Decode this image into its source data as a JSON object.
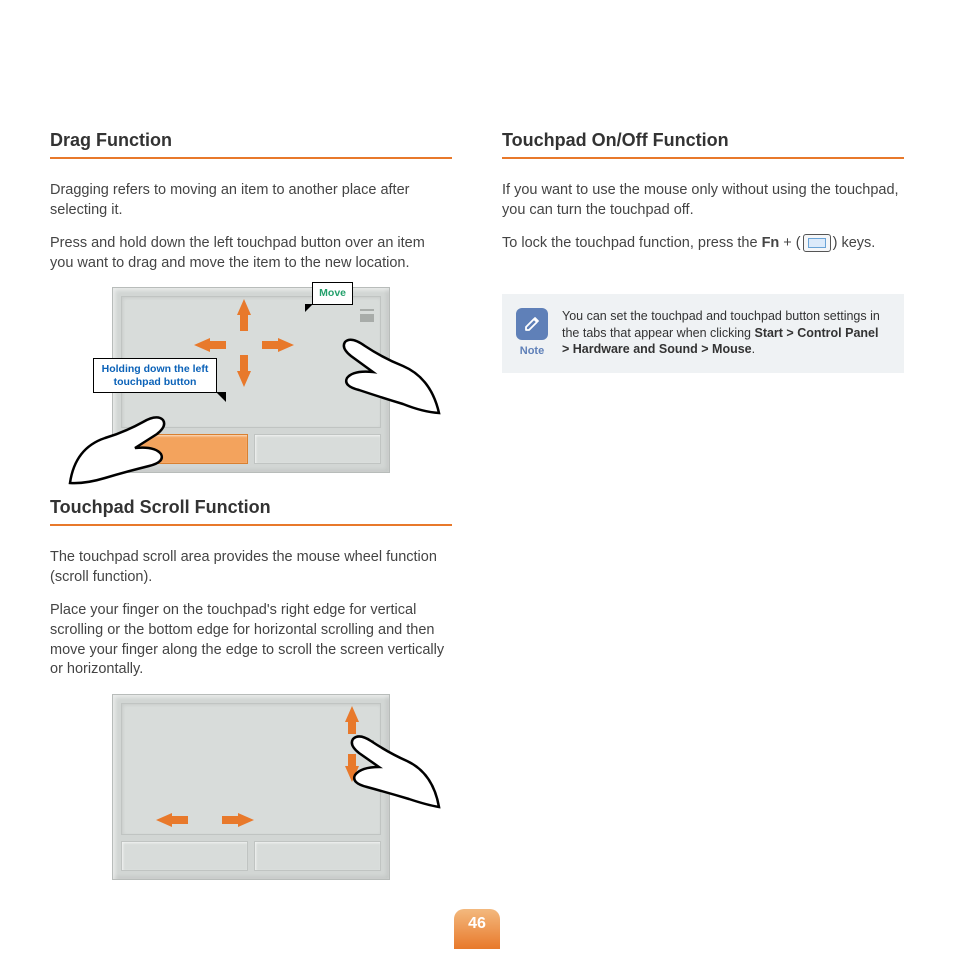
{
  "left": {
    "section1": {
      "heading": "Drag Function",
      "p1": "Dragging refers to moving an item to another place after selecting it.",
      "p2": "Press and hold down the left touchpad button over an item you want to drag and move the item to the new location.",
      "callout_hold": "Holding down the left touchpad button",
      "callout_move": "Move"
    },
    "section2": {
      "heading": "Touchpad Scroll Function",
      "p1": "The touchpad scroll area provides the mouse wheel function (scroll function).",
      "p2": "Place your finger on the touchpad's right edge for vertical scrolling or the bottom edge for horizontal scrolling and then move your finger along the edge to scroll the screen vertically or horizontally."
    }
  },
  "right": {
    "heading": "Touchpad On/Off Function",
    "p1": "If you want to use the mouse only without using the touchpad, you can turn the touchpad off.",
    "p2a": "To lock the touchpad function, press the ",
    "p2_fn": "Fn",
    "p2b": " + (",
    "p2c": ") keys.",
    "note": {
      "label": "Note",
      "text_a": "You can set the touchpad and touchpad button settings in the tabs that appear when clicking ",
      "path": "Start > Control Panel > Hardware and Sound > Mouse",
      "text_b": "."
    }
  },
  "page_number": "46"
}
